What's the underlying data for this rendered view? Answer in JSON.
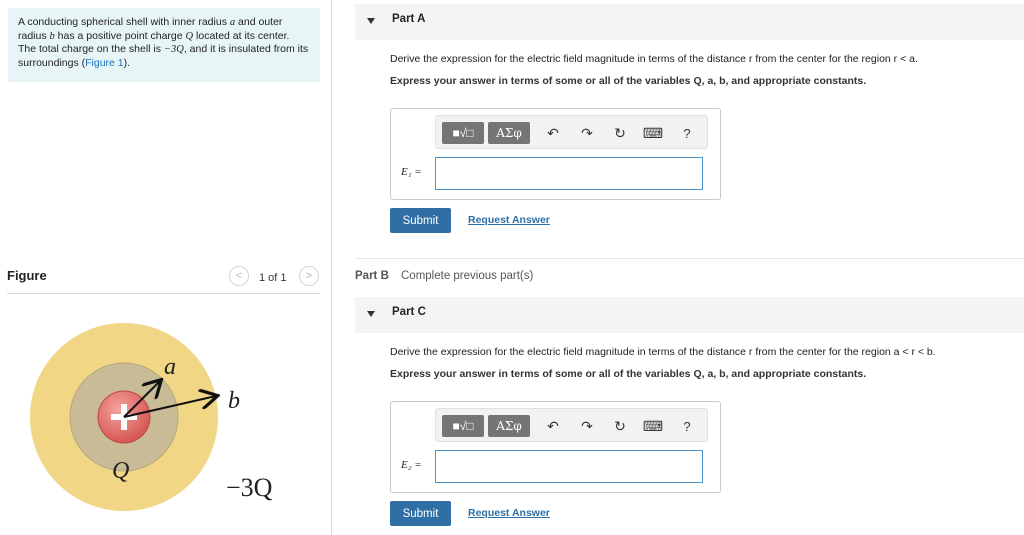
{
  "problem": {
    "text_1": "A conducting spherical shell with inner radius ",
    "var_a": "a",
    "text_2": " and outer radius ",
    "var_b": "b",
    "text_3": " has a positive point charge ",
    "var_Q": "Q",
    "text_4": " located at its center. The total charge on the shell is ",
    "charge_expr": "−3Q",
    "text_5": ", and it is insulated from its surroundings (",
    "figure_link": "Figure 1",
    "text_6": ")."
  },
  "figure": {
    "title": "Figure",
    "pager_prev": "<",
    "pager_text": "1 of 1",
    "pager_next": ">",
    "labels": {
      "a": "a",
      "b": "b",
      "Q": "Q",
      "shell_charge": "−3Q"
    },
    "colors": {
      "outer_shell": "#f1d785",
      "cavity": "#c9bb95",
      "charge": "#e26b67",
      "arrow": "#111111"
    }
  },
  "toolbar": {
    "template_glyph": "■√□",
    "greek_label": "ΑΣφ",
    "undo_icon": "↶",
    "redo_icon": "↷",
    "reset_icon": "↻",
    "keyboard_icon": "⌨",
    "help_label": "?"
  },
  "partA": {
    "label": "Part A",
    "question": "Derive the expression for the electric field magnitude in terms of the distance r from the center for the region r < a.",
    "instruction": "Express your answer in terms of some or all of the variables Q, a, b, and appropriate constants.",
    "var_label": "E₁ =",
    "input_value": "",
    "submit": "Submit",
    "request": "Request Answer"
  },
  "partB": {
    "label": "Part B",
    "status": "Complete previous part(s)"
  },
  "partC": {
    "label": "Part C",
    "question": "Derive the expression for the electric field magnitude in terms of the distance r from the center for the region a < r < b.",
    "instruction": "Express your answer in terms of some or all of the variables Q, a, b, and appropriate constants.",
    "var_label": "E₂ =",
    "input_value": "",
    "submit": "Submit",
    "request": "Request Answer"
  }
}
